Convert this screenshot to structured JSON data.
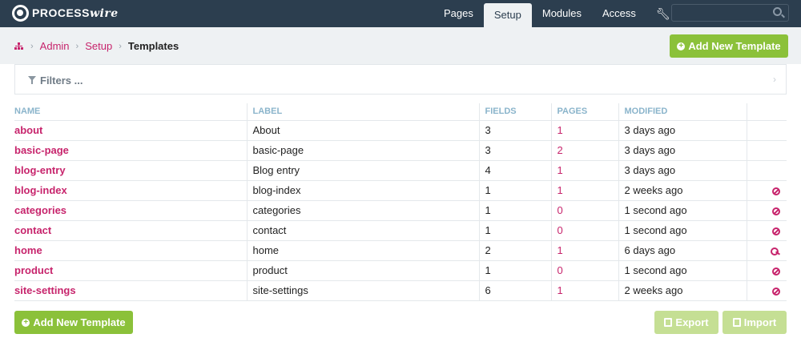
{
  "brand": {
    "name_prefix": "PROCESS",
    "name_suffix": "wire"
  },
  "nav": {
    "items": [
      {
        "label": "Pages",
        "active": false
      },
      {
        "label": "Setup",
        "active": true
      },
      {
        "label": "Modules",
        "active": false
      },
      {
        "label": "Access",
        "active": false
      }
    ],
    "wrench_icon": "wrench-icon"
  },
  "search": {
    "placeholder": "",
    "icon": "search-icon"
  },
  "breadcrumb": {
    "home_icon": "sitemap-icon",
    "items": [
      "Admin",
      "Setup"
    ],
    "current": "Templates"
  },
  "actions": {
    "add_label": "Add New Template",
    "export_label": "Export",
    "import_label": "Import"
  },
  "filters": {
    "label": "Filters ..."
  },
  "table": {
    "headers": [
      "NAME",
      "LABEL",
      "FIELDS",
      "PAGES",
      "MODIFIED"
    ],
    "rows": [
      {
        "name": "about",
        "label": "About",
        "fields": "3",
        "pages": "1",
        "modified": "3 days ago",
        "icon": ""
      },
      {
        "name": "basic-page",
        "label": "basic-page",
        "fields": "3",
        "pages": "2",
        "modified": "3 days ago",
        "icon": ""
      },
      {
        "name": "blog-entry",
        "label": "Blog entry",
        "fields": "4",
        "pages": "1",
        "modified": "3 days ago",
        "icon": ""
      },
      {
        "name": "blog-index",
        "label": "blog-index",
        "fields": "1",
        "pages": "1",
        "modified": "2 weeks ago",
        "icon": "ban-icon"
      },
      {
        "name": "categories",
        "label": "categories",
        "fields": "1",
        "pages": "0",
        "modified": "1 second ago",
        "icon": "ban-icon"
      },
      {
        "name": "contact",
        "label": "contact",
        "fields": "1",
        "pages": "0",
        "modified": "1 second ago",
        "icon": "ban-icon"
      },
      {
        "name": "home",
        "label": "home",
        "fields": "2",
        "pages": "1",
        "modified": "6 days ago",
        "icon": "key-icon"
      },
      {
        "name": "product",
        "label": "product",
        "fields": "1",
        "pages": "0",
        "modified": "1 second ago",
        "icon": "ban-icon"
      },
      {
        "name": "site-settings",
        "label": "site-settings",
        "fields": "6",
        "pages": "1",
        "modified": "2 weeks ago",
        "icon": "ban-icon"
      }
    ]
  },
  "colors": {
    "topbar": "#2c3e4f",
    "accent": "#c7246c",
    "green": "#8bc13a",
    "green_light": "#c5df94"
  }
}
